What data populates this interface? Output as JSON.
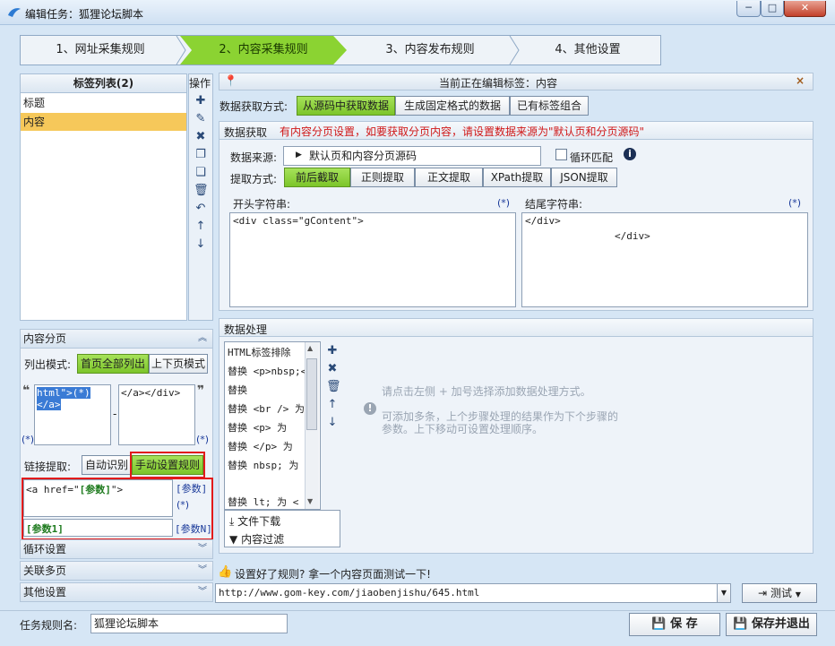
{
  "window": {
    "title": "编辑任务：狐狸论坛脚本",
    "min_glyph": "─",
    "max_glyph": "□",
    "close_glyph": "✕"
  },
  "steps": [
    {
      "label": "1、网址采集规则"
    },
    {
      "label": "2、内容采集规则"
    },
    {
      "label": "3、内容发布规则"
    },
    {
      "label": "4、其他设置"
    }
  ],
  "tag_list": {
    "header": "标签列表(2)",
    "items": [
      "标题",
      "内容"
    ],
    "ops_label": "操作"
  },
  "pagination": {
    "section_title": "内容分页",
    "mode_label": "列出模式:",
    "mode_all": "首页全部列出",
    "mode_updown": "上下页模式",
    "quote_left": "❝",
    "quote_right": "❞",
    "start_line1": "html\">(*)",
    "start_line2": "</a>",
    "dash": "-",
    "end_text": "</a></div>",
    "star_left": "(*)",
    "star_right": "(*)",
    "link_label": "链接提取:",
    "link_auto": "自动识别",
    "link_manual": "手动设置规则",
    "rule_prefix": "<a href=\"",
    "rule_param": "[参数]",
    "rule_suffix": "\">",
    "rule_param_tag": "[参数]",
    "rule_star": "(*)",
    "rule_box2": "[参数1]",
    "rule_paramN": "[参数N]"
  },
  "sections": {
    "loop": "循环设置",
    "multi": "关联多页",
    "other": "其他设置"
  },
  "editor": {
    "editing_label": "当前正在编辑标签：内容",
    "close": "×",
    "source_mode_label": "数据获取方式:",
    "source_modes": [
      "从源码中获取数据",
      "生成固定格式的数据",
      "已有标签组合"
    ],
    "data_title": "数据获取",
    "warning": "有内容分页设置，如要获取分页内容，请设置数据来源为\"默认页和分页源码\"",
    "source_label": "数据来源:",
    "source_value": "默认页和内容分页源码",
    "loop_match": "循环匹配",
    "info": "i",
    "extract_label": "提取方式:",
    "extract_modes": [
      "前后截取",
      "正则提取",
      "正文提取",
      "XPath提取",
      "JSON提取"
    ],
    "start_label": "开头字符串:",
    "start_star": "(*)",
    "start_value": "<div class=\"gContent\">",
    "end_label": "结尾字符串:",
    "end_star": "(*)",
    "end_value": "</div>",
    "end_value2": "</div>"
  },
  "processing": {
    "title": "数据处理",
    "items": [
      "HTML标签排除",
      "替换 <p>nbsp;<",
      "替换",
      "替换 <br /> 为",
      "替换 <p> 为",
      "替换 </p> 为",
      "替换 nbsp; 为",
      "替换 lt; 为 <"
    ],
    "download": "文件下载",
    "filter": "内容过滤",
    "hint1": "请点击左侧 + 加号选择添加数据处理方式。",
    "hint2": "可添加多条，上个步骤处理的结果作为下个步骤的",
    "hint3": "参数。上下移动可设置处理顺序。"
  },
  "test": {
    "label": "设置好了规则? 拿一个内容页面测试一下!",
    "url": "http://www.gom-key.com/jiaobenjishu/645.html",
    "button": "测试"
  },
  "bottom": {
    "name_label": "任务规则名:",
    "name_value": "狐狸论坛脚本",
    "save": "保 存",
    "save_exit": "保存并退出"
  },
  "colors": {
    "accent_green": "#8bd332",
    "selected_row": "#f6c85a",
    "warning_red": "#d01818",
    "highlight_border": "#e21b1b"
  }
}
